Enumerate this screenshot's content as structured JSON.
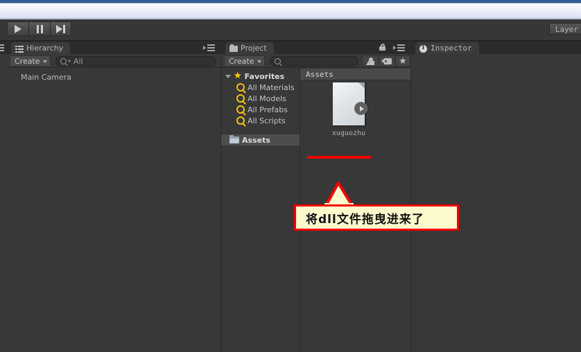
{
  "window": {
    "chrome_style": "windows-light-gradient"
  },
  "toolbar": {
    "play_button": "play-icon",
    "pause_button": "pause-icon",
    "step_button": "step-icon",
    "layers_label": "Layer"
  },
  "panels": {
    "hierarchy": {
      "tab_label": "Hierarchy",
      "tab_icon": "hierarchy-list-icon",
      "create_label": "Create",
      "search_placeholder": "All",
      "items": [
        {
          "label": "Main Camera"
        }
      ]
    },
    "project": {
      "tab_label": "Project",
      "tab_icon": "folder-icon",
      "create_label": "Create",
      "search_placeholder": "",
      "lock_icon": "lock-icon",
      "filter_buttons": [
        {
          "name": "filter-by-type-button",
          "icon": "shapes-icon"
        },
        {
          "name": "filter-by-label-button",
          "icon": "tag-icon"
        },
        {
          "name": "favorites-filter-button",
          "icon": "star-icon"
        }
      ],
      "tree": [
        {
          "label": "Favorites",
          "icon": "star-icon",
          "expanded": true,
          "indent": 0,
          "selected": false,
          "bold": true
        },
        {
          "label": "All Materials",
          "icon": "search-icon",
          "indent": 1,
          "selected": false,
          "bold": false
        },
        {
          "label": "All Models",
          "icon": "search-icon",
          "indent": 1,
          "selected": false,
          "bold": false
        },
        {
          "label": "All Prefabs",
          "icon": "search-icon",
          "indent": 1,
          "selected": false,
          "bold": false
        },
        {
          "label": "All Scripts",
          "icon": "search-icon",
          "indent": 1,
          "selected": false,
          "bold": false
        },
        {
          "label": "Assets",
          "icon": "folder-icon",
          "indent": 0,
          "selected": true,
          "bold": true
        }
      ],
      "breadcrumb": "Assets",
      "assets": [
        {
          "name": "xuguozhu",
          "icon": "document-file-icon",
          "badge": "expand-arrow-icon"
        }
      ]
    },
    "inspector": {
      "tab_label": "Inspector",
      "tab_icon": "info-icon"
    }
  },
  "annotation": {
    "underline_color": "#f50000",
    "callout_text": "将dll文件拖曳进来了",
    "callout_fill": "#fcfacd",
    "callout_border": "#f50000"
  }
}
